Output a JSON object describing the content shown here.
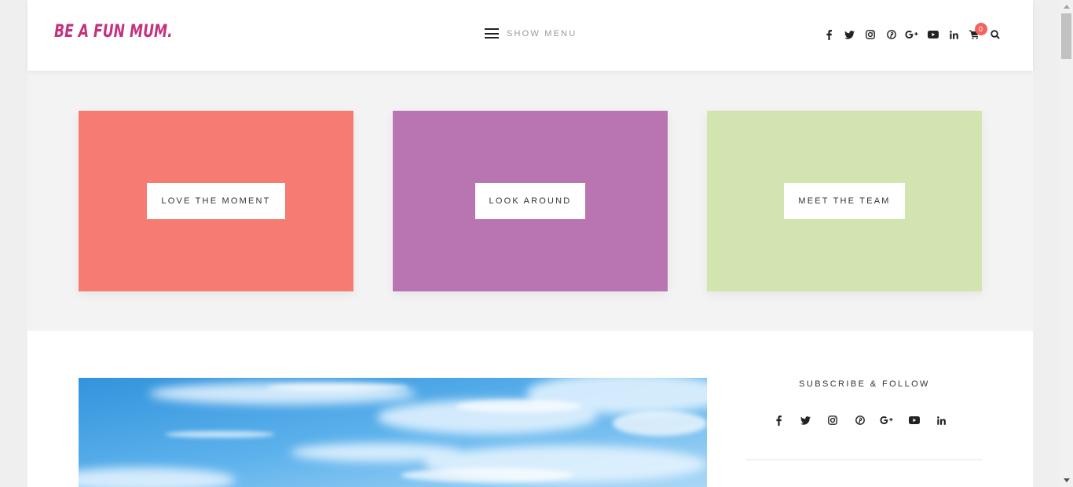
{
  "header": {
    "logo_text": "BE A FUN MUM.",
    "menu_label": "SHOW MENU",
    "cart_count": "0",
    "social_icons": [
      "facebook-icon",
      "twitter-icon",
      "instagram-icon",
      "pinterest-icon",
      "google-plus-icon",
      "youtube-icon",
      "linkedin-icon"
    ]
  },
  "tiles": [
    {
      "label": "LOVE THE MOMENT",
      "color": "#f67b73"
    },
    {
      "label": "LOOK AROUND",
      "color": "#b974b2"
    },
    {
      "label": "MEET THE TEAM",
      "color": "#d2e4b0"
    }
  ],
  "sidebar": {
    "title": "SUBSCRIBE & FOLLOW",
    "social_icons": [
      "facebook-icon",
      "twitter-icon",
      "instagram-icon",
      "pinterest-icon",
      "google-plus-icon",
      "youtube-icon",
      "linkedin-icon"
    ]
  },
  "colors": {
    "brand": "#c4317e",
    "badge": "#f2635f",
    "sky": "#3a9ae0"
  }
}
